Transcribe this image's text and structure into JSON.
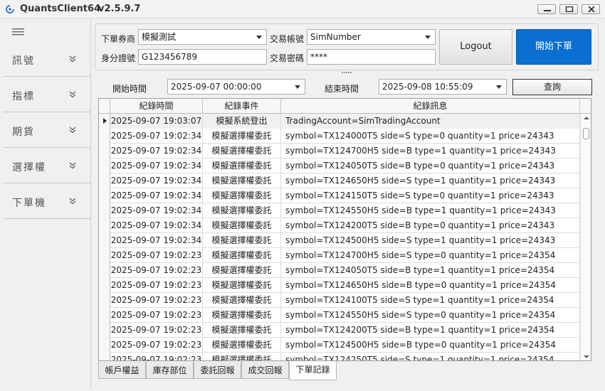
{
  "window": {
    "title": "QuantsClient64",
    "version": "v2.5.9.7"
  },
  "sidebar": {
    "items": [
      {
        "label": "訊號"
      },
      {
        "label": "指標"
      },
      {
        "label": "期貨"
      },
      {
        "label": "選擇權"
      },
      {
        "label": "下單機"
      }
    ]
  },
  "account": {
    "broker_label": "下單券商",
    "broker_value": "模擬測試",
    "trade_account_label": "交易帳號",
    "trade_account_value": "SimNumber",
    "id_label": "身分證號",
    "id_value": "G123456789",
    "password_label": "交易密碼",
    "password_value": "****",
    "logout_label": "Logout",
    "start_order_label": "開始下單"
  },
  "query": {
    "start_label": "開始時間",
    "start_value": "2025-09-07 00:00:00",
    "end_label": "結束時間",
    "end_value": "2025-09-08 10:55:09",
    "query_label": "查詢"
  },
  "grid": {
    "columns": [
      "紀錄時間",
      "紀錄事件",
      "紀錄訊息"
    ],
    "rows": [
      {
        "time": "2025-09-07 19:03:07",
        "event": "模擬系統登出",
        "message": "TradingAccount=SimTradingAccount"
      },
      {
        "time": "2025-09-07 19:02:34",
        "event": "模擬選擇權委託",
        "message": "symbol=TX124000T5 side=S type=0 quantity=1 price=24343"
      },
      {
        "time": "2025-09-07 19:02:34",
        "event": "模擬選擇權委託",
        "message": "symbol=TX124700H5 side=B type=1 quantity=1 price=24343"
      },
      {
        "time": "2025-09-07 19:02:34",
        "event": "模擬選擇權委託",
        "message": "symbol=TX124050T5 side=B type=0 quantity=1 price=24343"
      },
      {
        "time": "2025-09-07 19:02:34",
        "event": "模擬選擇權委託",
        "message": "symbol=TX124650H5 side=S type=1 quantity=1 price=24343"
      },
      {
        "time": "2025-09-07 19:02:34",
        "event": "模擬選擇權委託",
        "message": "symbol=TX124150T5 side=S type=0 quantity=1 price=24343"
      },
      {
        "time": "2025-09-07 19:02:34",
        "event": "模擬選擇權委託",
        "message": "symbol=TX124550H5 side=B type=1 quantity=1 price=24343"
      },
      {
        "time": "2025-09-07 19:02:34",
        "event": "模擬選擇權委託",
        "message": "symbol=TX124200T5 side=B type=0 quantity=1 price=24343"
      },
      {
        "time": "2025-09-07 19:02:34",
        "event": "模擬選擇權委託",
        "message": "symbol=TX124500H5 side=S type=1 quantity=1 price=24343"
      },
      {
        "time": "2025-09-07 19:02:23",
        "event": "模擬選擇權委託",
        "message": "symbol=TX124700H5 side=S type=0 quantity=1 price=24354"
      },
      {
        "time": "2025-09-07 19:02:23",
        "event": "模擬選擇權委託",
        "message": "symbol=TX124050T5 side=B type=1 quantity=1 price=24354"
      },
      {
        "time": "2025-09-07 19:02:23",
        "event": "模擬選擇權委託",
        "message": "symbol=TX124650H5 side=B type=0 quantity=1 price=24354"
      },
      {
        "time": "2025-09-07 19:02:23",
        "event": "模擬選擇權委託",
        "message": "symbol=TX124100T5 side=S type=1 quantity=1 price=24354"
      },
      {
        "time": "2025-09-07 19:02:23",
        "event": "模擬選擇權委託",
        "message": "symbol=TX124550H5 side=S type=0 quantity=1 price=24354"
      },
      {
        "time": "2025-09-07 19:02:23",
        "event": "模擬選擇權委託",
        "message": "symbol=TX124200T5 side=B type=1 quantity=1 price=24354"
      },
      {
        "time": "2025-09-07 19:02:23",
        "event": "模擬選擇權委託",
        "message": "symbol=TX124500H5 side=B type=0 quantity=1 price=24354"
      },
      {
        "time": "2025-09-07 19:02:23",
        "event": "模擬選擇權委託",
        "message": "symbol=TX124250T5 side=S type=1 quantity=1 price=24354"
      }
    ]
  },
  "tabs": [
    {
      "label": "帳戶權益"
    },
    {
      "label": "庫存部位"
    },
    {
      "label": "委託回報"
    },
    {
      "label": "成交回報"
    },
    {
      "label": "下單記錄"
    }
  ],
  "colors": {
    "accent": "#0a6fd0",
    "selected_row": "#f0f0f0"
  }
}
